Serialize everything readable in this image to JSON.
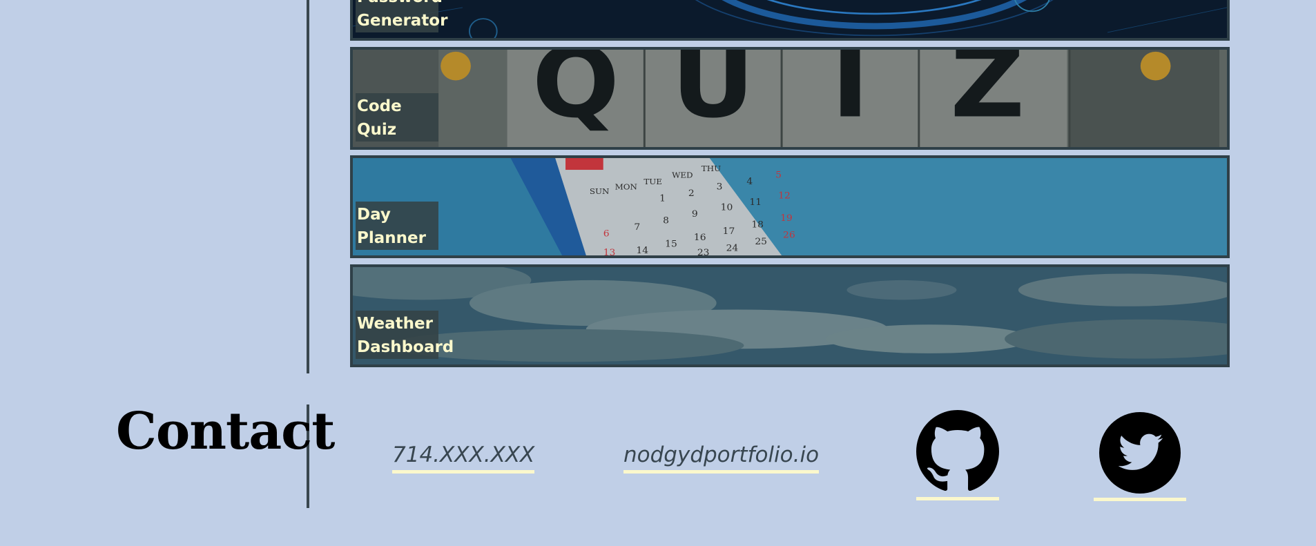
{
  "portfolio": {
    "projects": [
      {
        "title": "Password\nGenerator",
        "theme": "#0d1f33"
      },
      {
        "title": "Code Quiz",
        "theme": "#6b7370"
      },
      {
        "title": "Day\nPlanner",
        "theme": "#3a85a8"
      },
      {
        "title": "Weather\nDashboard",
        "theme": "#3c5a6a"
      }
    ]
  },
  "quiz_banner": {
    "letters": [
      "Q",
      "U",
      "I",
      "Z"
    ]
  },
  "planner_calendar": {
    "weekdays": [
      "SUN",
      "MON",
      "TUE",
      "WED",
      "THU"
    ],
    "dates": [
      "1",
      "2",
      "3",
      "4",
      "5",
      "6",
      "7",
      "8",
      "9",
      "10",
      "11",
      "12",
      "13",
      "14",
      "15",
      "16",
      "17",
      "18",
      "19",
      "23",
      "24",
      "25",
      "26"
    ]
  },
  "contact": {
    "title": "Contact",
    "phone": "714.XXX.XXX",
    "website": "nodgydportfolio.io",
    "github_icon": "github-icon",
    "twitter_icon": "twitter-icon"
  },
  "colors": {
    "background": "#c0cfe7",
    "divider": "#39474f",
    "label_text": "#fbf8cc",
    "link_text": "#384650",
    "underline": "#fbf8cc"
  }
}
